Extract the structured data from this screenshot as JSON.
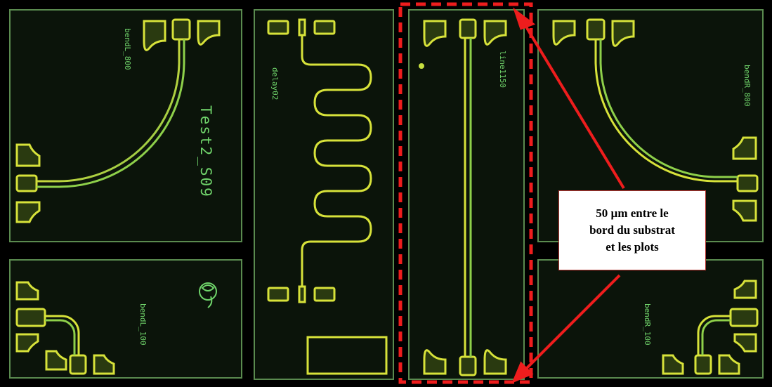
{
  "image": {
    "kind": "optical micrograph of test chip with coplanar structures",
    "colors": {
      "background": "#000000",
      "substrate": "#0b140a",
      "border": "#5a8a4f",
      "metal": "#d7e23a",
      "label": "#6fd36a",
      "annotation": "#ee1d1d"
    }
  },
  "labels": {
    "bend_l800_top_left": "bendL_800",
    "test_name": "Test2_S09",
    "delay": "delay02",
    "line": "line1150",
    "bend_r800_top_right": "bendR_800",
    "bend_l100": "bendL_100",
    "bend_r100": "bendR_100"
  },
  "callout": {
    "line1": "50 µm entre le",
    "line2": "bord du substrat",
    "line3": "et les plots"
  }
}
